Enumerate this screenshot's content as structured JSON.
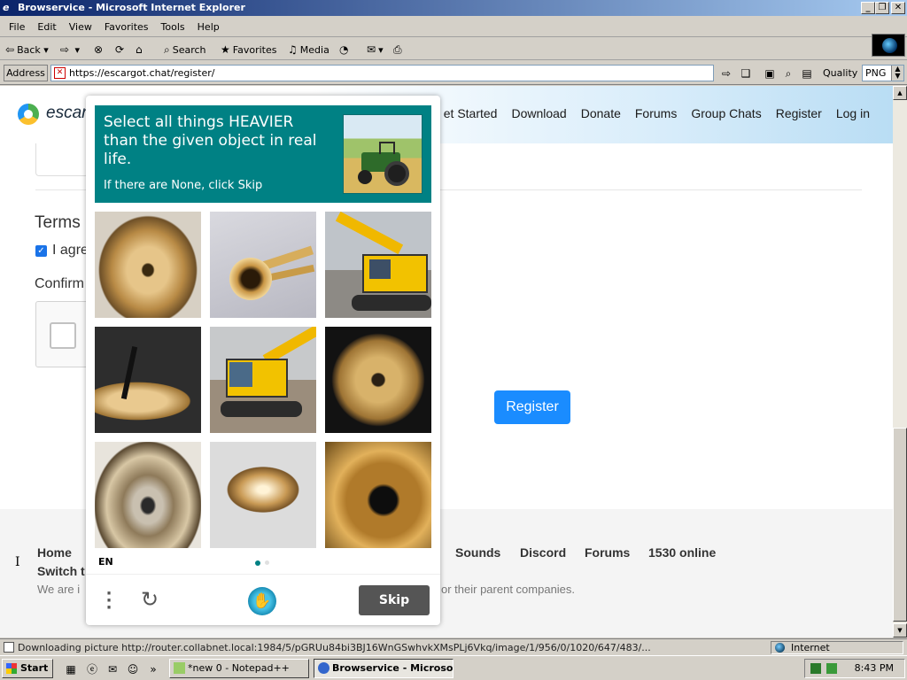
{
  "window": {
    "title": "Browservice - Microsoft Internet Explorer",
    "minimize_label": "_",
    "restore_label": "❐",
    "close_label": "✕",
    "icon_glyph": "e"
  },
  "menu": [
    "File",
    "Edit",
    "View",
    "Favorites",
    "Tools",
    "Help"
  ],
  "toolbar": {
    "back": "Back",
    "search": "Search",
    "favorites": "Favorites",
    "media": "Media"
  },
  "address": {
    "label": "Address",
    "url": "https://escargot.chat/register/",
    "quality_label": "Quality",
    "quality_value": "PNG"
  },
  "site": {
    "brand": "escar",
    "nav": [
      "et Started",
      "Download",
      "Donate",
      "Forums",
      "Group Chats",
      "Register",
      "Log in"
    ],
    "terms_heading": "Terms",
    "agree_label": "I agre",
    "confirm_label": "Confirm",
    "register_button": "Register",
    "footer": {
      "row1": [
        "Home",
        "Sounds",
        "Discord",
        "Forums",
        "1530 online"
      ],
      "row2_start": "Switch t",
      "text_start": "We are i",
      "text_end": "or their parent companies."
    }
  },
  "captcha": {
    "prompt_title": "Select all things HEAVIER than the given object in real life.",
    "prompt_sub": "If there are None, click Skip",
    "prompt_image": "tractor",
    "tiles": [
      "cymbal",
      "trumpet",
      "excavator",
      "cymbal",
      "excavator",
      "cymbal",
      "cymbal",
      "cymbal",
      "cymbal"
    ],
    "language": "EN",
    "skip_button": "Skip",
    "accent_color": "#008184"
  },
  "status": {
    "text": "Downloading picture http://router.collabnet.local:1984/5/pGRUu84bi3BJ16WnGSwhvkXMsPLj6Vkq/image/1/956/0/1020/647/483/...",
    "zone": "Internet"
  },
  "taskbar": {
    "start": "Start",
    "tasks": [
      "*new 0 - Notepad++",
      "Browservice - Microso..."
    ],
    "clock": "8:43 PM",
    "quicklaunch_more": "»"
  }
}
